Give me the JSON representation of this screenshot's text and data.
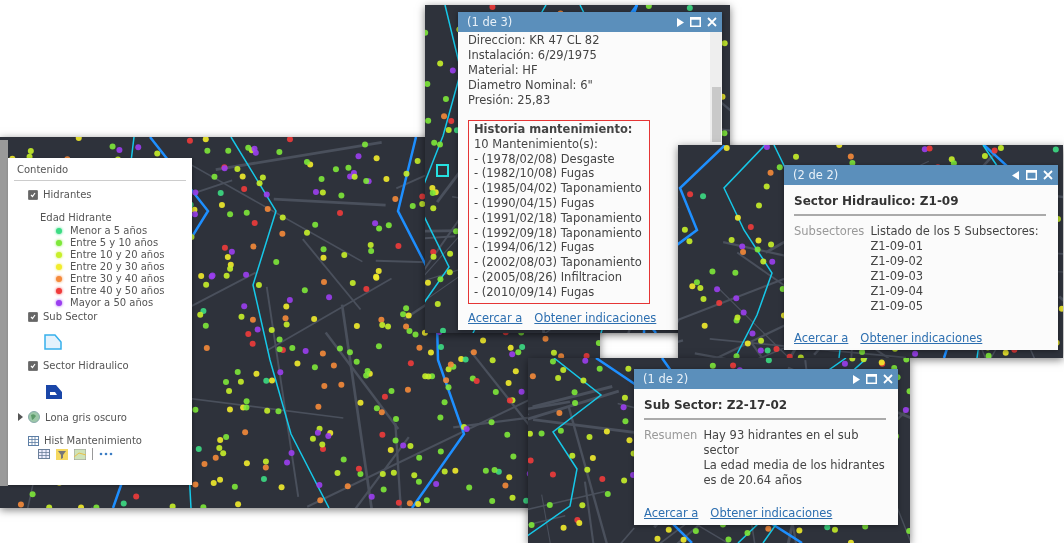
{
  "legend_panel": {
    "title": "Contenido",
    "layers": [
      {
        "kind": "layer",
        "label": "Hidrantes",
        "checked": true,
        "legend_title": "Edad Hidrante",
        "classes": [
          {
            "label": "Menor a 5 años",
            "color": "#3ddc84"
          },
          {
            "label": "Entre 5 y 10 años",
            "color": "#7ee83a"
          },
          {
            "label": "Entre 10 y 20 años",
            "color": "#c8ef2a"
          },
          {
            "label": "Entre 20 y 30 años",
            "color": "#f2ec2c"
          },
          {
            "label": "Entre 30 y 40 años",
            "color": "#f58a3a"
          },
          {
            "label": "Entre 40 y 50 años",
            "color": "#f03b3b"
          },
          {
            "label": "Mayor a 50 años",
            "color": "#9b3ef0"
          }
        ]
      },
      {
        "kind": "layer",
        "label": "Sub Sector",
        "checked": true,
        "symbol": {
          "kind": "outline"
        }
      },
      {
        "kind": "layer",
        "label": "Sector Hidraulico",
        "checked": true,
        "symbol": {
          "kind": "filled"
        }
      },
      {
        "kind": "basemap",
        "label": "Lona gris oscuro",
        "expanded": false
      },
      {
        "kind": "table",
        "label": "Hist Mantenimiento"
      }
    ]
  },
  "popups": [
    {
      "kind": "history",
      "page": "(1 de 3)",
      "nav": {
        "kind": "next"
      },
      "fields": [
        "Direccion: KR 47 CL 82",
        "Instalación: 6/29/1975",
        "Material: HF",
        "Diametro Nominal: 6\"",
        "Presión: 25,83"
      ],
      "history": {
        "title": "Historia mantenimiento:",
        "lines": [
          "10 Mantenimiento(s):",
          "- (1978/02/08) Desgaste",
          "- (1982/10/08) Fugas",
          "- (1985/04/02) Taponamiento",
          "- (1990/04/15) Fugas",
          "- (1991/02/18) Taponamiento",
          "- (1992/09/18) Taponamiento",
          "- (1994/06/12) Fugas",
          "- (2002/08/03) Taponamiento",
          "- (2005/08/26) Infiltracion",
          "- (2010/09/14) Fugas"
        ]
      },
      "links": [
        "Acercar a",
        "Obtener indicaciones"
      ]
    },
    {
      "kind": "attributes",
      "page": "(2 de 2)",
      "nav": {
        "kind": "prev"
      },
      "title": "Sector Hidraulico: Z1-09",
      "rows": [
        {
          "label": "Subsectores",
          "lines": [
            "Listado de los 5 Subsectores:",
            "Z1-09-01",
            "Z1-09-02",
            "Z1-09-03",
            "Z1-09-04",
            "Z1-09-05"
          ]
        }
      ],
      "links": [
        "Acercar a",
        "Obtener indicaciones"
      ]
    },
    {
      "kind": "attributes",
      "page": "(1 de 2)",
      "nav": {
        "kind": "next"
      },
      "title": "Sub Sector: Z2-17-02",
      "rows": [
        {
          "label": "Resumen",
          "lines": [
            "Hay 93 hidrantes en el sub sector",
            "La edad media de los hidrantes es de 20.64 años"
          ]
        }
      ],
      "links": [
        "Acercar a",
        "Obtener indicaciones"
      ]
    }
  ]
}
